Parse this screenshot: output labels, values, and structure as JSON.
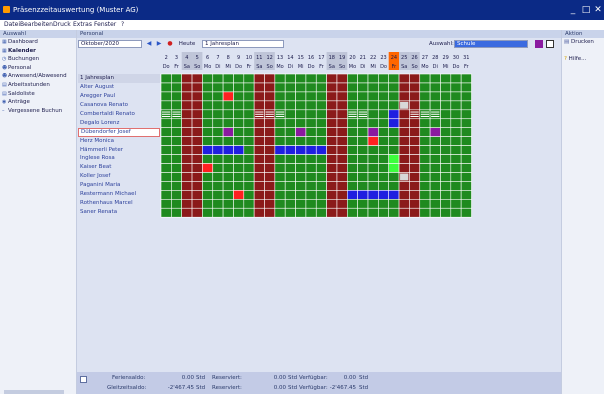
{
  "window": {
    "title": "Präsenzzeitauswertung (Muster AG)",
    "controls": [
      "_",
      "□",
      "✕"
    ]
  },
  "menu": [
    "Datei",
    "Bearbeiten",
    "Druck",
    "Extras",
    "Fenster",
    "?"
  ],
  "left_panel": {
    "title": "Auswahl",
    "items": [
      {
        "label": "Dashboard",
        "icon": "dashboard-icon",
        "active": false
      },
      {
        "label": "Kalender",
        "icon": "calendar-icon",
        "active": true
      },
      {
        "label": "Buchungen",
        "icon": "clock-icon",
        "active": false
      },
      {
        "label": "Personal",
        "icon": "people-icon",
        "active": false
      },
      {
        "label": "Anwesend/Abwesend",
        "icon": "presence-icon",
        "active": false
      },
      {
        "label": "Arbeitsstunden",
        "icon": "hours-icon",
        "active": false
      },
      {
        "label": "Saldoliste",
        "icon": "list-icon",
        "active": false
      },
      {
        "label": "Anträge",
        "icon": "request-icon",
        "active": false
      },
      {
        "label": "Vergessene Buchun",
        "icon": "dash-icon",
        "active": false
      }
    ]
  },
  "main": {
    "section_title": "Personal",
    "month": "Oktober/2020",
    "today_label": "Heute",
    "plan_label": "1 Jahresplan",
    "selection_label": "Auswahl:",
    "selection_value": "Schule",
    "days": [
      "2",
      "3",
      "4",
      "5",
      "6",
      "7",
      "8",
      "9",
      "10",
      "11",
      "12",
      "13",
      "14",
      "15",
      "16",
      "17",
      "18",
      "19",
      "20",
      "21",
      "22",
      "23",
      "24",
      "25",
      "26",
      "27",
      "28",
      "29",
      "30",
      "31"
    ],
    "weekdays": [
      "Do",
      "Fr",
      "Sa",
      "So",
      "Mo",
      "Di",
      "Mi",
      "Do",
      "Fr",
      "Sa",
      "So",
      "Mo",
      "Di",
      "Mi",
      "Do",
      "Fr",
      "Sa",
      "So",
      "Mo",
      "Di",
      "Mi",
      "Do",
      "Fr",
      "Sa",
      "So",
      "Mo",
      "Di",
      "Mi",
      "Do",
      "Fr"
    ],
    "rows": [
      "1 Jahresplan",
      "Alter August",
      "Aregger Paul",
      "Casanova Renato",
      "Combertaldi Renato",
      "Degalo Lorenz",
      "Dübendorfer Josef",
      "Herz Monica",
      "Hämmerli Peter",
      "Inglese Rosa",
      "Kaiser Beat",
      "Koller Josef",
      "Paganini Maria",
      "Restermann Michael",
      "Rothenhaus Marcel",
      "Saner Renata"
    ],
    "summary": {
      "ferien_label": "Feriensaldo:",
      "ferien_value": "0.00",
      "unit1": "Std",
      "reserviert_label": "Reserviert:",
      "reserviert1": "0.00",
      "unit2": "Std",
      "verfuegbar_label": "Verfügbar:",
      "verfuegbar1": "0.00",
      "unit3": "Std",
      "gleit_label": "Gleitzeitsaldo:",
      "gleit_value": "-2'467.45",
      "unit4": "Std",
      "reserviert2": "0.00",
      "unit5": "Std",
      "verfuegbar2": "-2'467.45",
      "unit6": "Std"
    }
  },
  "right_panel": {
    "title": "Aktion",
    "items": [
      {
        "label": "Drucken",
        "icon": "printer-icon"
      },
      {
        "label": "Hilfe...",
        "icon": "help-icon"
      }
    ]
  },
  "colors": {
    "titlebar": "#0b2a86",
    "present": "#1f8a1f",
    "weekend": "#8b1a1a",
    "absence_blue": "#1f1fe0",
    "red": "#ff2020",
    "purple": "#8a1aa0",
    "bright_green": "#3cff3c",
    "today": "#ff6600"
  }
}
